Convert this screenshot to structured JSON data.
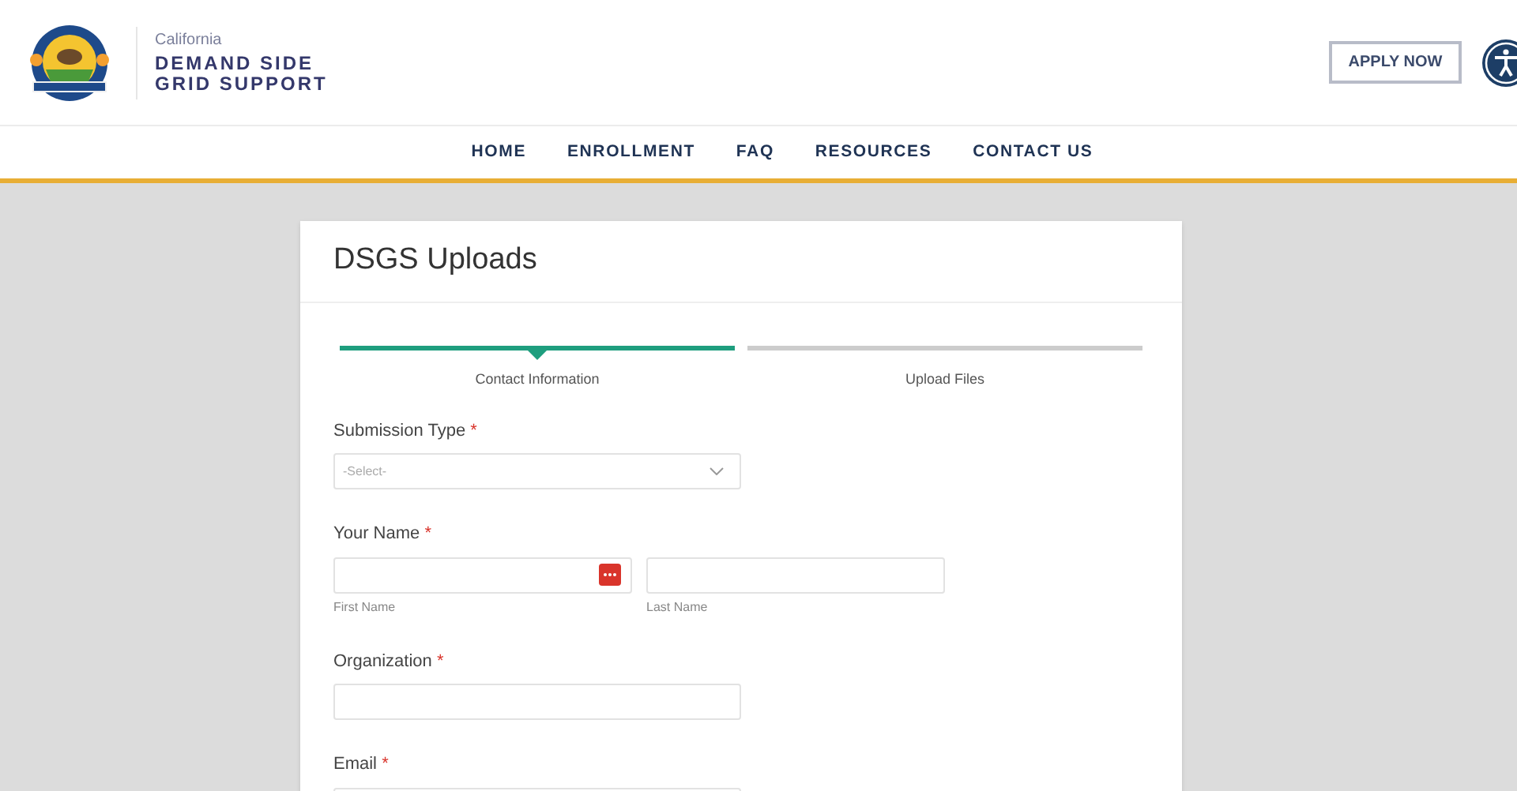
{
  "header": {
    "brand_small": "California",
    "brand_line_1": "DEMAND SIDE",
    "brand_line_2": "GRID SUPPORT",
    "apply_button": "APPLY NOW"
  },
  "nav": [
    {
      "label": "HOME"
    },
    {
      "label": "ENROLLMENT"
    },
    {
      "label": "FAQ"
    },
    {
      "label": "RESOURCES"
    },
    {
      "label": "CONTACT US"
    }
  ],
  "card": {
    "title": "DSGS Uploads",
    "steps": [
      {
        "label": "Contact Information",
        "selected": true
      },
      {
        "label": "Upload Files",
        "selected": false
      }
    ],
    "fields": [
      {
        "kind": "select",
        "label": "Submission Type",
        "required_mark": "*",
        "placeholder": "-Select-"
      },
      {
        "kind": "name",
        "label": "Your Name",
        "required_mark": "*",
        "sub_labels": [
          "First Name",
          "Last Name"
        ]
      },
      {
        "kind": "text",
        "label": "Organization",
        "required_mark": "*"
      },
      {
        "kind": "text",
        "label": "Email",
        "required_mark": "*"
      }
    ]
  }
}
